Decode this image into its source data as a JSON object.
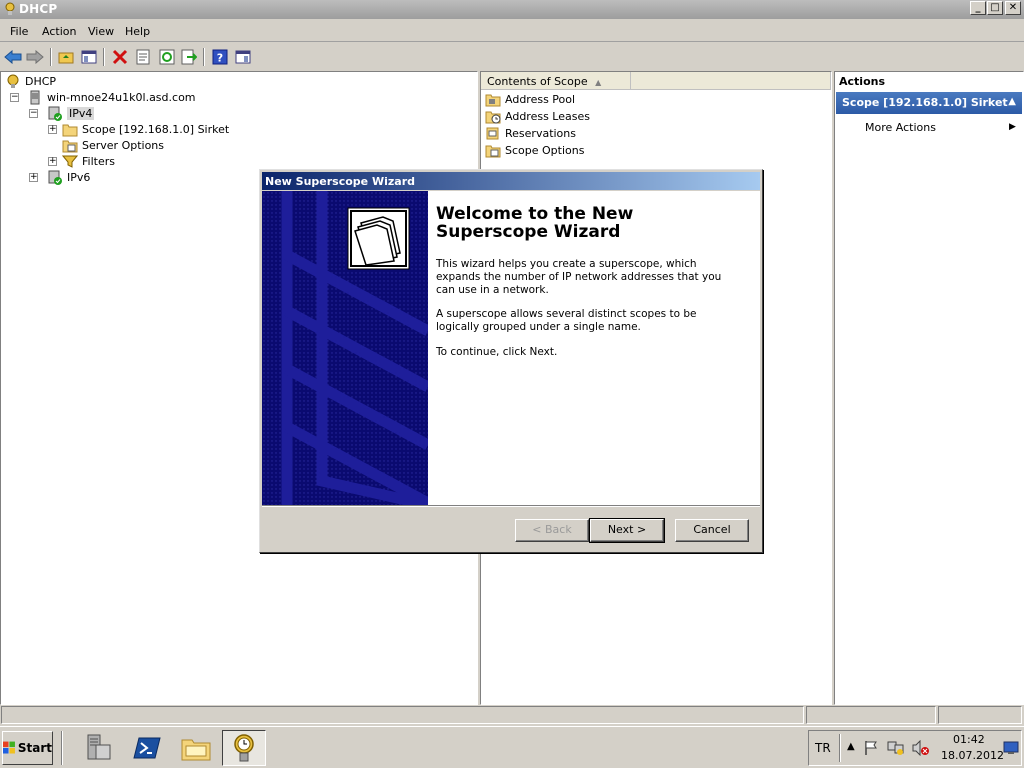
{
  "window": {
    "title": "DHCP",
    "min": "_",
    "max": "□",
    "close": "✕"
  },
  "menu": [
    "File",
    "Action",
    "View",
    "Help"
  ],
  "tree": {
    "root": "DHCP",
    "server": "win-mnoe24u1k0l.asd.com",
    "ipv4": "IPv4",
    "scope": "Scope [192.168.1.0] Sirket",
    "server_options": "Server Options",
    "filters": "Filters",
    "ipv6": "IPv6",
    "expand": "+",
    "collapse": "−"
  },
  "center": {
    "column_header": "Contents of Scope",
    "items": [
      "Address Pool",
      "Address Leases",
      "Reservations",
      "Scope Options"
    ]
  },
  "actions": {
    "title": "Actions",
    "section": "Scope [192.168.1.0] Sirket",
    "more": "More Actions"
  },
  "wizard": {
    "title": "New Superscope Wizard",
    "heading": "Welcome to the New Superscope Wizard",
    "p1": "This wizard helps you create a superscope, which expands the number of IP network addresses that you can use in a network.",
    "p2": "A superscope allows several distinct scopes to be logically grouped under a single name.",
    "p3": "To continue, click Next.",
    "back": "< Back",
    "next": "Next >",
    "cancel": "Cancel"
  },
  "taskbar": {
    "start": "Start",
    "lang": "TR",
    "time": "01:42",
    "date": "18.07.2012"
  },
  "colors": {
    "accent": "#0a246a",
    "wizard_side": "#0a0a6e",
    "action_header": "#2c5aa6"
  }
}
